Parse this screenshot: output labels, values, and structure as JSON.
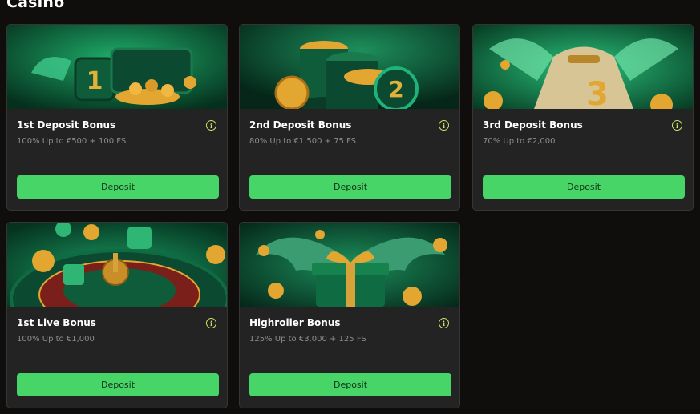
{
  "section": {
    "title": "Casino"
  },
  "cards": [
    {
      "title": "1st Deposit Bonus",
      "subtitle": "100% Up to €500 + 100 FS",
      "button": "Deposit"
    },
    {
      "title": "2nd Deposit Bonus",
      "subtitle": "80% Up to €1,500 + 75 FS",
      "button": "Deposit"
    },
    {
      "title": "3rd Deposit Bonus",
      "subtitle": "70% Up to €2,000",
      "button": "Deposit"
    },
    {
      "title": "1st Live Bonus",
      "subtitle": "100% Up to €1,000",
      "button": "Deposit"
    },
    {
      "title": "Highroller Bonus",
      "subtitle": "125% Up to €3,000 + 125 FS",
      "button": "Deposit"
    }
  ],
  "banner_labels": {
    "card1": "1",
    "card2": "2",
    "card3": "3"
  },
  "colors": {
    "background": "#0f0e0d",
    "card": "#232323",
    "accent_green": "#46d566",
    "info_icon": "#c9e86a",
    "gold": "#e2a631"
  }
}
